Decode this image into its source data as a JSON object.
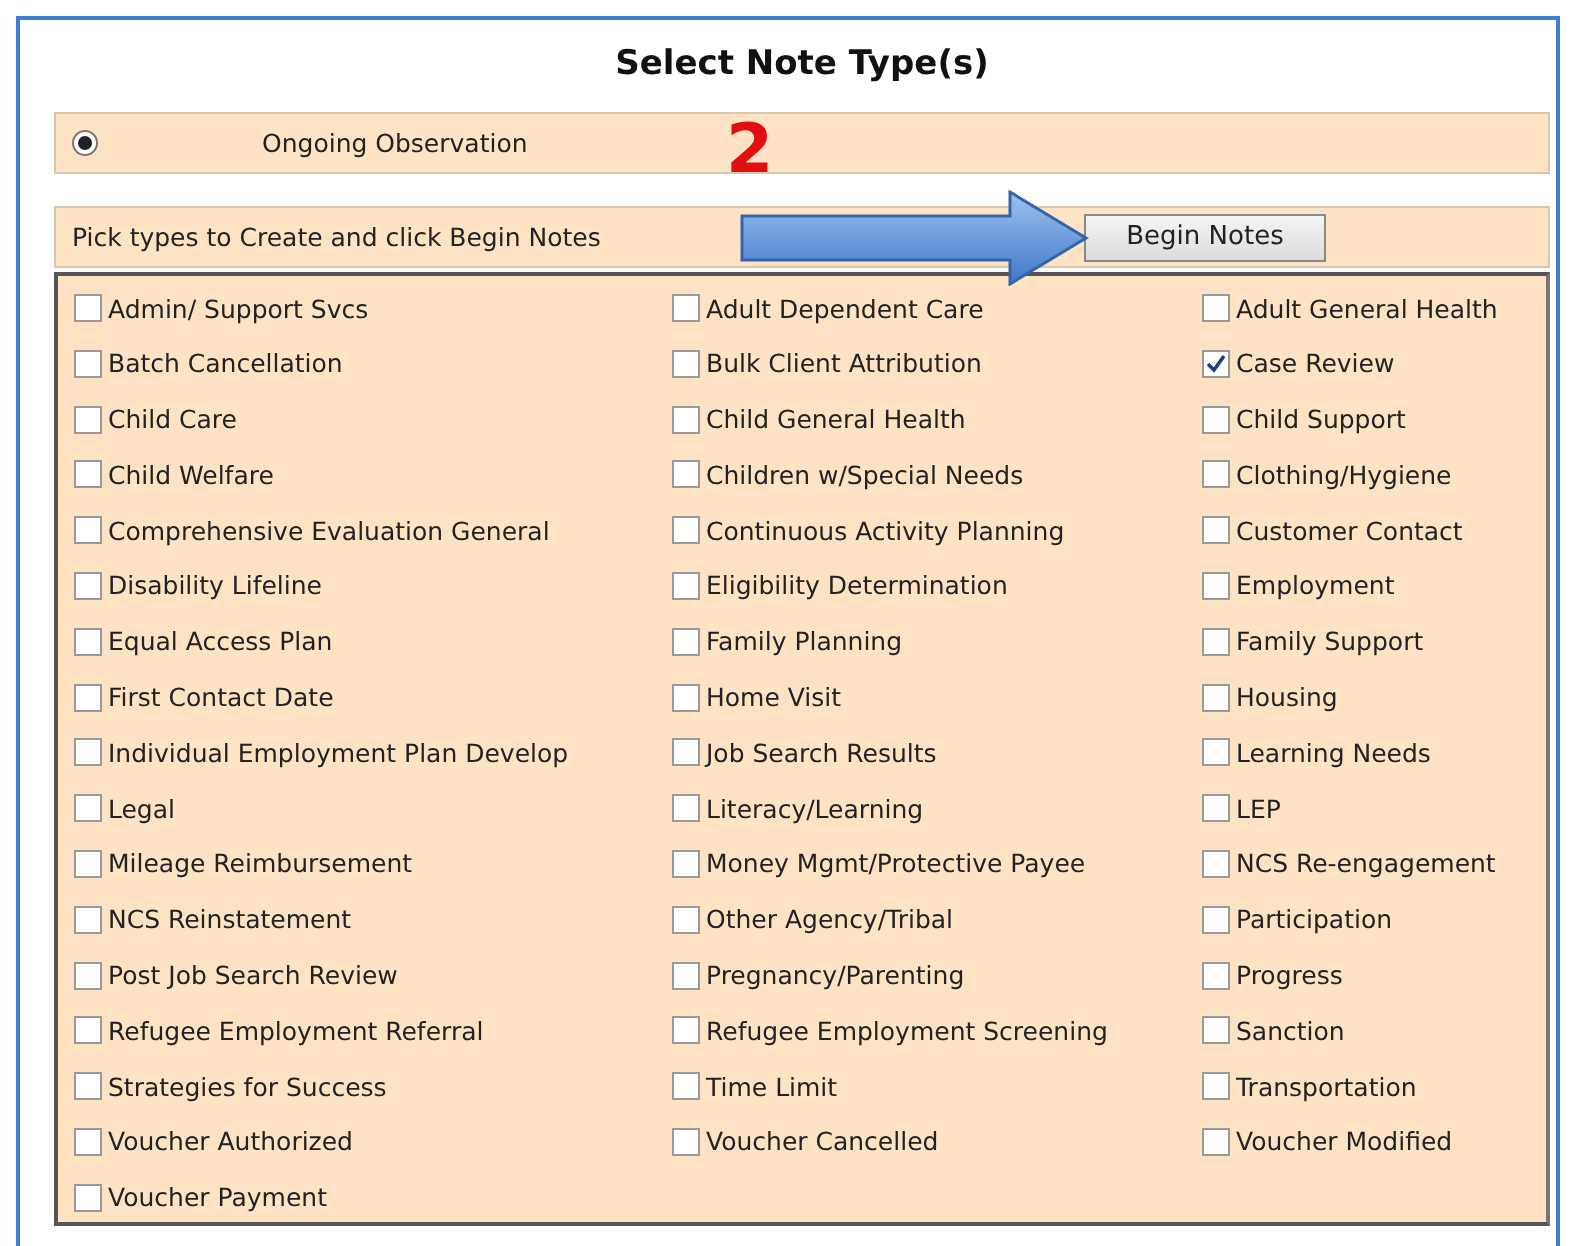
{
  "title": "Select Note Type(s)",
  "observation": {
    "label": "Ongoing Observation",
    "selected": true
  },
  "annotation": {
    "step": "2"
  },
  "instruction": "Pick types to Create and click Begin Notes",
  "begin_button": "Begin Notes",
  "note_types": [
    {
      "label": "Admin/ Support Svcs",
      "checked": false
    },
    {
      "label": "Adult Dependent Care",
      "checked": false
    },
    {
      "label": "Adult General Health",
      "checked": false
    },
    {
      "label": "Batch Cancellation",
      "checked": false
    },
    {
      "label": "Bulk Client Attribution",
      "checked": false
    },
    {
      "label": "Case Review",
      "checked": true
    },
    {
      "label": "Child Care",
      "checked": false
    },
    {
      "label": "Child General Health",
      "checked": false
    },
    {
      "label": "Child Support",
      "checked": false
    },
    {
      "label": "Child Welfare",
      "checked": false
    },
    {
      "label": "Children w/Special Needs",
      "checked": false
    },
    {
      "label": "Clothing/Hygiene",
      "checked": false
    },
    {
      "label": "Comprehensive Evaluation General",
      "checked": false
    },
    {
      "label": "Continuous Activity Planning",
      "checked": false
    },
    {
      "label": "Customer Contact",
      "checked": false
    },
    {
      "label": "Disability Lifeline",
      "checked": false
    },
    {
      "label": "Eligibility Determination",
      "checked": false
    },
    {
      "label": "Employment",
      "checked": false
    },
    {
      "label": "Equal Access Plan",
      "checked": false
    },
    {
      "label": "Family Planning",
      "checked": false
    },
    {
      "label": "Family Support",
      "checked": false
    },
    {
      "label": "First Contact Date",
      "checked": false
    },
    {
      "label": "Home Visit",
      "checked": false
    },
    {
      "label": "Housing",
      "checked": false
    },
    {
      "label": "Individual Employment Plan Develop",
      "checked": false
    },
    {
      "label": "Job Search Results",
      "checked": false
    },
    {
      "label": "Learning Needs",
      "checked": false
    },
    {
      "label": "Legal",
      "checked": false
    },
    {
      "label": "Literacy/Learning",
      "checked": false
    },
    {
      "label": "LEP",
      "checked": false
    },
    {
      "label": "Mileage Reimbursement",
      "checked": false
    },
    {
      "label": "Money Mgmt/Protective Payee",
      "checked": false
    },
    {
      "label": "NCS Re-engagement",
      "checked": false
    },
    {
      "label": "NCS Reinstatement",
      "checked": false
    },
    {
      "label": "Other Agency/Tribal",
      "checked": false
    },
    {
      "label": "Participation",
      "checked": false
    },
    {
      "label": "Post Job Search Review",
      "checked": false
    },
    {
      "label": "Pregnancy/Parenting",
      "checked": false
    },
    {
      "label": "Progress",
      "checked": false
    },
    {
      "label": "Refugee Employment Referral",
      "checked": false
    },
    {
      "label": "Refugee Employment Screening",
      "checked": false
    },
    {
      "label": "Sanction",
      "checked": false
    },
    {
      "label": "Strategies for Success",
      "checked": false
    },
    {
      "label": "Time Limit",
      "checked": false
    },
    {
      "label": "Transportation",
      "checked": false
    },
    {
      "label": "Voucher Authorized",
      "checked": false
    },
    {
      "label": "Voucher Cancelled",
      "checked": false
    },
    {
      "label": "Voucher Modified",
      "checked": false
    },
    {
      "label": "Voucher Payment",
      "checked": false
    }
  ]
}
